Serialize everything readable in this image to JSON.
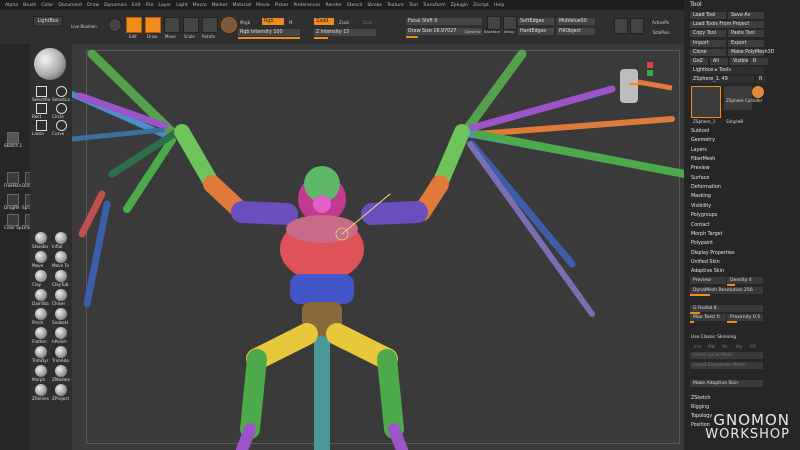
{
  "menu": [
    "Alpha",
    "Brush",
    "Color",
    "Document",
    "Draw",
    "Dynamics",
    "Edit",
    "File",
    "Layer",
    "Light",
    "Macro",
    "Marker",
    "Material",
    "Movie",
    "Picker",
    "Preferences",
    "Render",
    "Stencil",
    "Stroke",
    "Texture",
    "Tool",
    "Transform",
    "Zplugin",
    "Zscript",
    "Help"
  ],
  "toolbar": {
    "lightbox": "LightBox",
    "live_boolean": "Live Boolean",
    "edit": "Edit",
    "draw": "Draw",
    "move": "Move",
    "scale": "Scale",
    "rotate": "Rotate",
    "mrgb": "Mrgb",
    "rgb": "Rgb",
    "m": "M",
    "rgb_intensity": "Rgb Intensity 100",
    "zadd": "Zadd",
    "zsub": "Zsub",
    "zcut": "Zcut",
    "z_intensity": "Z Intensity 15",
    "focal_shift": "Focal Shift 0",
    "draw_size": "Draw Size 16.97027",
    "dynamic": "Dynamic",
    "soft_edges": "SoftEdges",
    "hard_edges": "HardEdges",
    "midvalue": "MidValue50",
    "fill_object": "FillObject",
    "backface": "Backface",
    "setup": "Setup",
    "active_points": "ActivePo",
    "total_points": "TotalPoin"
  },
  "left_shelf": [
    {
      "label": "Sketch 1"
    },
    {
      "label": "FreeHan"
    },
    {
      "label": "Dots"
    },
    {
      "label": "DragRe"
    },
    {
      "label": "Spray"
    },
    {
      "label": "Color Sp"
    },
    {
      "label": "DragDo"
    }
  ],
  "left_panel_tools": [
    "SelectRe",
    "SelectLa",
    "Rect",
    "Circle",
    "Lasso",
    "Curve"
  ],
  "brushes": [
    [
      "Standar",
      "InflaI"
    ],
    [
      "Move",
      "Move To"
    ],
    [
      "Clay",
      "ClayTub"
    ],
    [
      "DamSta",
      "Chisel"
    ],
    [
      "Pinch",
      "SnakeH"
    ],
    [
      "Flatten",
      "hPolish"
    ],
    [
      "TrimDyr",
      "TrimAdo"
    ],
    [
      "Morph",
      "ZModele"
    ],
    [
      "ZRemes",
      "ZProject"
    ]
  ],
  "right_panel": {
    "title": "Tool",
    "buttons": [
      [
        "Load Tool",
        "Save As"
      ],
      [
        "Load Tools From Project"
      ],
      [
        "Copy Tool",
        "Paste Tool"
      ],
      [
        "Import",
        "Export"
      ],
      [
        "Clone",
        "Make PolyMesh3D"
      ],
      [
        "GoZ",
        "All",
        "Visible",
        "R"
      ],
      [
        "Lightbox ▸ Tools"
      ],
      [
        "ZSphere_1. 49",
        "R"
      ]
    ],
    "thumbs": [
      "ZSphere_1",
      "ZSphere Cylinder",
      "SimpleB"
    ],
    "menu_items": [
      "Subtool",
      "Geometry",
      "Layers",
      "FiberMesh",
      "Preview",
      "Surface",
      "Deformation",
      "Masking",
      "Visibility",
      "Polygroups",
      "Contact",
      "Morph Target",
      "Polypaint",
      "Display Properties",
      "Unified Skin",
      "Adaptive Skin"
    ],
    "adaptive": {
      "preview": "Preview",
      "density": "Density 4",
      "dynamesh": "DynaMesh Resolution 256",
      "g_radial": "G Radial 8",
      "max_twist": "Max Twist 0",
      "proximity": "Proximity 0.5",
      "classic": "Use Classic Skinning",
      "opts": [
        "Ires",
        "Mbr",
        "Mc",
        "Mp",
        "PD"
      ],
      "insert_local": "Insert Local Mesh",
      "insert_connector": "Insert Connector Mesh",
      "make": "Make Adaptive Skin"
    },
    "bottom_items": [
      "ZSketch",
      "Rigging",
      "Topology",
      "Position"
    ]
  },
  "watermark": {
    "line1": "GNOMON",
    "line2": "WORKSHOP"
  },
  "colors": {
    "accent": "#f08a1a",
    "bg": "#2b2b2b",
    "canvas": "#3a3a3a"
  }
}
